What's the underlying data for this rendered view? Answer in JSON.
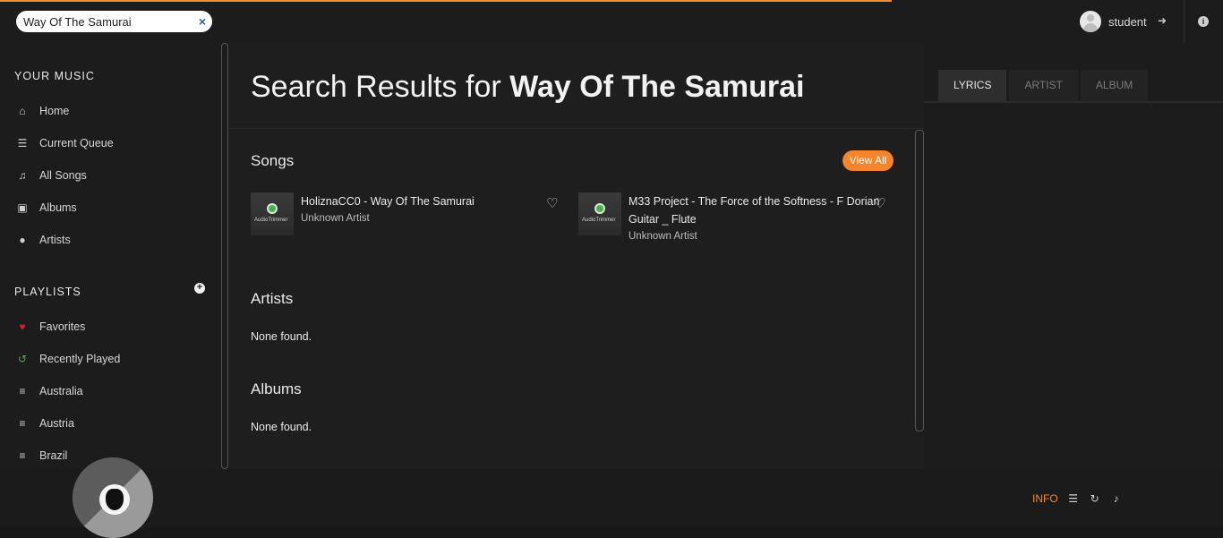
{
  "top": {
    "search_value": "Way Of The Samurai",
    "clear_icon": "×",
    "username": "student"
  },
  "sidebar": {
    "your_music_title": "YOUR MUSIC",
    "music_items": [
      {
        "label": "Home",
        "icon": "home-icon"
      },
      {
        "label": "Current Queue",
        "icon": "list-icon"
      },
      {
        "label": "All Songs",
        "icon": "music-note-icon"
      },
      {
        "label": "Albums",
        "icon": "album-icon"
      },
      {
        "label": "Artists",
        "icon": "microphone-icon"
      }
    ],
    "playlists_title": "PLAYLISTS",
    "playlist_items": [
      {
        "label": "Favorites",
        "icon": "heart-icon",
        "color": "#d81b3c"
      },
      {
        "label": "Recently Played",
        "icon": "history-icon",
        "color": "#4caf50"
      },
      {
        "label": "Australia",
        "icon": "document-icon"
      },
      {
        "label": "Austria",
        "icon": "document-icon"
      },
      {
        "label": "Brazil",
        "icon": "document-icon"
      }
    ]
  },
  "main": {
    "title_prefix": "Search Results for ",
    "title_query": "Way Of The Samurai",
    "songs_heading": "Songs",
    "view_all_label": "View All",
    "songs": [
      {
        "title": "HoliznaCC0 - Way Of The Samurai",
        "artist": "Unknown Artist",
        "art_label": "AudioTrimmer"
      },
      {
        "title_line1": "M33 Project - The Force of the Softness - F Dorian",
        "title_line2": "Guitar _ Flute",
        "artist": "Unknown Artist",
        "art_label": "AudioTrimmer"
      }
    ],
    "artists_heading": "Artists",
    "artists_empty": "None found.",
    "albums_heading": "Albums",
    "albums_empty": "None found."
  },
  "right_panel": {
    "tabs": [
      "LYRICS",
      "ARTIST",
      "ALBUM"
    ],
    "active_tab": "LYRICS"
  },
  "player": {
    "info_label": "INFO",
    "accent_color": "#f58a2e"
  }
}
